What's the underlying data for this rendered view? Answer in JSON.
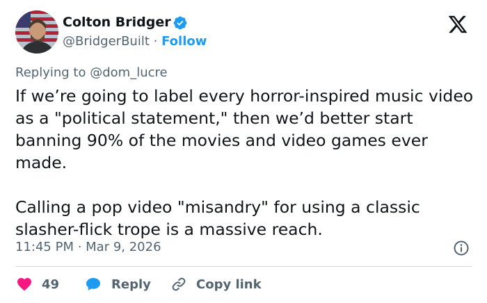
{
  "author": {
    "display_name": "Colton Bridger",
    "handle": "@BridgerBuilt",
    "separator": "·",
    "follow_label": "Follow",
    "verified": true
  },
  "reply_context": {
    "prefix": "Replying to",
    "handle": "@dom_lucre"
  },
  "tweet": {
    "text": "If we’re going to label every horror-inspired music video as a \"political statement,\" then we’d better start banning 90% of the movies and video games ever made.\n\nCalling a pop video \"misandry\" for using a classic slasher-flick trope is a massive reach.",
    "timestamp": "11:45 PM · Mar 9, 2026"
  },
  "actions": {
    "like_count": "49",
    "reply_label": "Reply",
    "copy_link_label": "Copy link"
  },
  "icons": {
    "verified": "verified-badge-icon",
    "logo": "x-logo-icon",
    "info": "info-icon",
    "like": "heart-icon",
    "reply": "speech-bubble-icon",
    "copy": "link-icon"
  },
  "colors": {
    "text": "#0f1419",
    "secondary": "#536471",
    "accent": "#1d9bf0",
    "like": "#f91880",
    "divider": "#cfd9de"
  }
}
